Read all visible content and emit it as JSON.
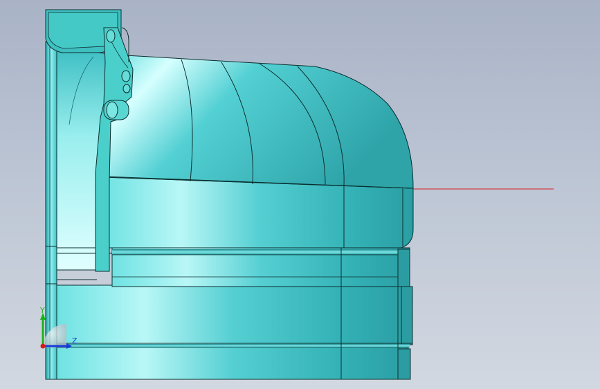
{
  "viewport": {
    "background_top": "#a9b3c6",
    "background_bottom": "#d2d8e1",
    "model_color": "#36b8bc",
    "edge_color": "#0b2e2e",
    "section_line_color": "#d22020"
  },
  "triad": {
    "y_label": "Y",
    "z_label": "Z",
    "y_color": "#19b319",
    "z_color": "#1a3ad8",
    "x_color": "#d41a1a"
  }
}
